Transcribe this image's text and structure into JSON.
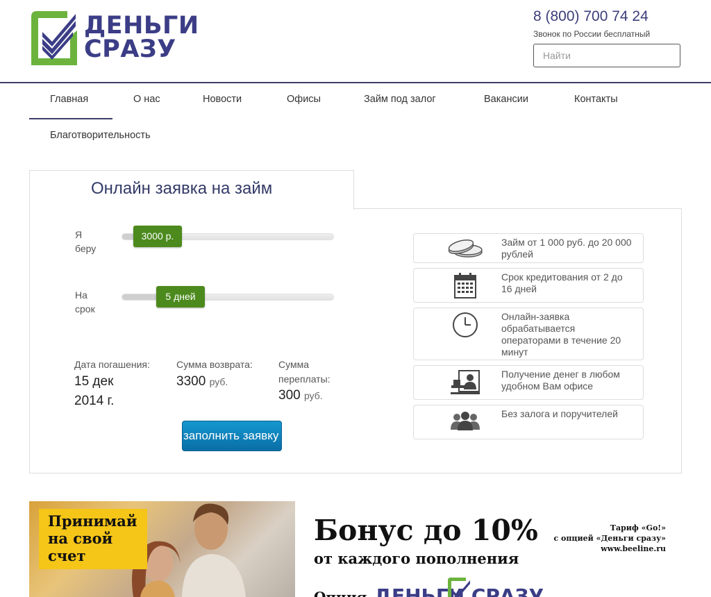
{
  "header": {
    "logo_text_line1": "ДЕНЬГИ",
    "logo_text_line2": "СРАЗУ",
    "phone": "8 (800) 700 74 24",
    "phone_note": "Звонок по России бесплатный",
    "search_placeholder": "Найти"
  },
  "nav": {
    "items": [
      {
        "label": "Главная",
        "active": true
      },
      {
        "label": "О нас"
      },
      {
        "label": "Новости"
      },
      {
        "label": "Офисы"
      },
      {
        "label": "Займ под залог"
      },
      {
        "label": "Вакансии"
      },
      {
        "label": "Контакты"
      },
      {
        "label": "Благотворительность"
      }
    ]
  },
  "calculator": {
    "title": "Онлайн заявка на займ",
    "amount_label": "Я беру",
    "amount_value": "3000 р.",
    "amount_fraction": 0.1,
    "term_label": "На срок",
    "term_value": "5 дней",
    "term_fraction": 0.2,
    "repay_date_label": "Дата погашения:",
    "repay_date_value": "15 дек 2014 г.",
    "return_sum_label": "Сумма возврата:",
    "return_sum_value": "3300",
    "return_sum_unit": "руб.",
    "overpay_label": "Сумма переплаты:",
    "overpay_value": "300",
    "overpay_unit": "руб.",
    "apply_button": "заполнить заявку"
  },
  "features": [
    {
      "icon": "coins-icon",
      "text": "Займ от 1 000 руб. до 20 000 рублей"
    },
    {
      "icon": "calendar-icon",
      "text": "Срок кредитования от 2 до 16 дней"
    },
    {
      "icon": "clock-icon",
      "text": "Онлайн-заявка обрабатывается операторами в течение 20 минут"
    },
    {
      "icon": "office-icon",
      "text": "Получение денег в любом удобном Вам офисе"
    },
    {
      "icon": "people-icon",
      "text": "Без залога и поручителей"
    }
  ],
  "banner": {
    "yellow_text": "Принимай на свой счет",
    "headline": "Бонус до 10%",
    "subline": "от каждого пополнения",
    "tariff_line1": "Тариф «Go!»",
    "tariff_line2": "с опцией «Деньги сразу»",
    "tariff_line3": "www.beeline.ru",
    "option_prefix": "Опция",
    "option_logo": "ДЕНЬГИ СРАЗУ"
  },
  "colors": {
    "brand_blue": "#3b3d86",
    "brand_green": "#6cb33e",
    "slider_green": "#4c8a1d",
    "button_blue": "#1286c0",
    "banner_yellow": "#f5c518"
  }
}
